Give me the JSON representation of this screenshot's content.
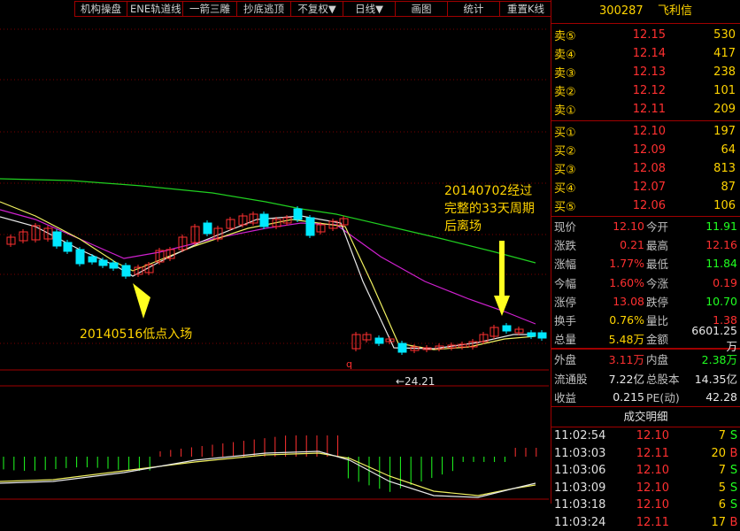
{
  "toolbar": {
    "buttons": [
      "机构操盘",
      "ENE轨道线",
      "一箭三雕",
      "抄底逃顶",
      "不复权▼",
      "日线▼",
      "画图",
      "统计",
      "重置K线"
    ]
  },
  "annotations": {
    "entry": "20140516低点入场",
    "exit_line1": "20140702经过",
    "exit_line2": "完整的33天周期",
    "exit_line3": "后离场",
    "low_label": "←24.21",
    "q_marker": "q"
  },
  "stock": {
    "code": "300287",
    "name": "飞利信"
  },
  "orderbook": {
    "asks": [
      {
        "label": "卖⑤",
        "price": "12.15",
        "vol": "530"
      },
      {
        "label": "卖④",
        "price": "12.14",
        "vol": "417"
      },
      {
        "label": "卖③",
        "price": "12.13",
        "vol": "238"
      },
      {
        "label": "卖②",
        "price": "12.12",
        "vol": "101"
      },
      {
        "label": "卖①",
        "price": "12.11",
        "vol": "209"
      }
    ],
    "bids": [
      {
        "label": "买①",
        "price": "12.10",
        "vol": "197"
      },
      {
        "label": "买②",
        "price": "12.09",
        "vol": "64"
      },
      {
        "label": "买③",
        "price": "12.08",
        "vol": "813"
      },
      {
        "label": "买④",
        "price": "12.07",
        "vol": "87"
      },
      {
        "label": "买⑤",
        "price": "12.06",
        "vol": "106"
      }
    ]
  },
  "stats": [
    {
      "l1": "现价",
      "v1": "12.10",
      "c1": "red",
      "l2": "今开",
      "v2": "11.91",
      "c2": "green"
    },
    {
      "l1": "涨跌",
      "v1": "0.21",
      "c1": "red",
      "l2": "最高",
      "v2": "12.16",
      "c2": "red"
    },
    {
      "l1": "涨幅",
      "v1": "1.77%",
      "c1": "red",
      "l2": "最低",
      "v2": "11.84",
      "c2": "green"
    },
    {
      "l1": "今幅",
      "v1": "1.60%",
      "c1": "red",
      "l2": "今涨",
      "v2": "0.19",
      "c2": "red"
    },
    {
      "l1": "涨停",
      "v1": "13.08",
      "c1": "red",
      "l2": "跌停",
      "v2": "10.70",
      "c2": "green"
    },
    {
      "l1": "换手",
      "v1": "0.76%",
      "c1": "yellow",
      "l2": "量比",
      "v2": "1.38",
      "c2": "red"
    },
    {
      "l1": "总量",
      "v1": "5.48万",
      "c1": "yellow",
      "l2": "金额",
      "v2": "6601.25万",
      "c2": "white"
    },
    {
      "l1": "外盘",
      "v1": "3.11万",
      "c1": "red",
      "l2": "内盘",
      "v2": "2.38万",
      "c2": "green"
    },
    {
      "l1": "流通股",
      "v1": "7.22亿",
      "c1": "white",
      "l2": "总股本",
      "v2": "14.35亿",
      "c2": "white"
    },
    {
      "l1": "收益",
      "v1": "0.215",
      "c1": "white",
      "l2": "PE(动)",
      "v2": "42.28",
      "c2": "white"
    }
  ],
  "trades_title": "成交明细",
  "trades": [
    {
      "time": "11:02:54",
      "price": "12.10",
      "vol": "7",
      "side": "S"
    },
    {
      "time": "11:03:03",
      "price": "12.11",
      "vol": "20",
      "side": "B"
    },
    {
      "time": "11:03:06",
      "price": "12.10",
      "vol": "7",
      "side": "S"
    },
    {
      "time": "11:03:09",
      "price": "12.10",
      "vol": "5",
      "side": "S"
    },
    {
      "time": "11:03:18",
      "price": "12.10",
      "vol": "6",
      "side": "S"
    },
    {
      "time": "11:03:24",
      "price": "12.11",
      "vol": "17",
      "side": "B"
    }
  ],
  "colors": {
    "up": "#ff3030",
    "down": "#00e8ff",
    "ma_green": "#20d020",
    "ma_magenta": "#d020d0",
    "ma_yellow": "#f0f060",
    "ma_white": "#e8e8e8",
    "border": "#a00000"
  }
}
